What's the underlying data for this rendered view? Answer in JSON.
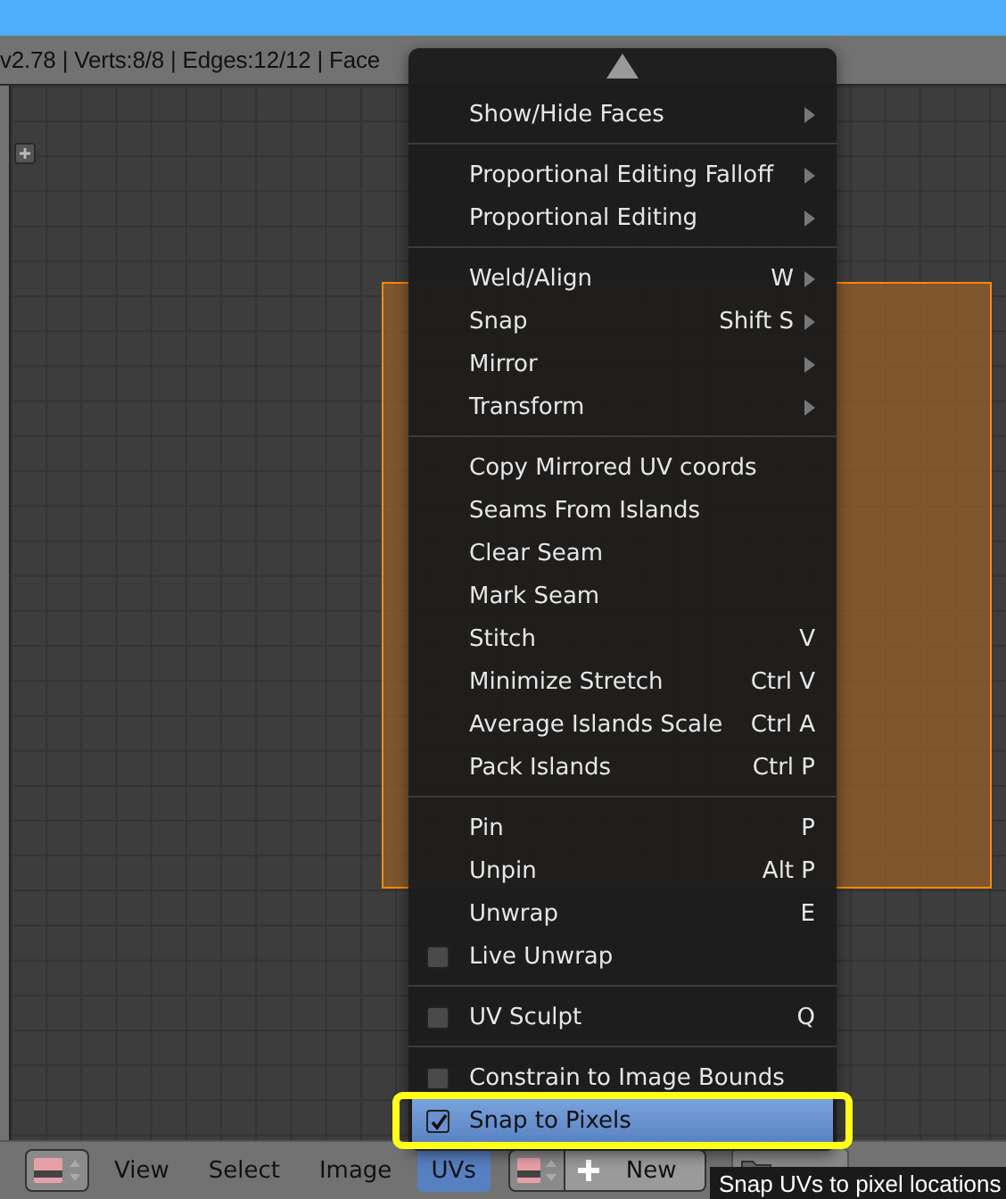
{
  "info_bar": {
    "text": "v2.78 | Verts:8/8 | Edges:12/12 | Face"
  },
  "menu": {
    "sections": [
      {
        "items": [
          {
            "kind": "item",
            "label": "Show/Hide Faces",
            "submenu": true,
            "selected": false
          }
        ]
      },
      {
        "items": [
          {
            "kind": "item",
            "label": "Proportional Editing Falloff",
            "submenu": true,
            "selected": false
          },
          {
            "kind": "item",
            "label": "Proportional Editing",
            "submenu": true,
            "selected": false
          }
        ]
      },
      {
        "items": [
          {
            "kind": "item",
            "label": "Weld/Align",
            "shortcut": "W",
            "submenu": true,
            "selected": false
          },
          {
            "kind": "item",
            "label": "Snap",
            "shortcut": "Shift S",
            "submenu": true,
            "selected": false
          },
          {
            "kind": "item",
            "label": "Mirror",
            "submenu": true,
            "selected": false
          },
          {
            "kind": "item",
            "label": "Transform",
            "submenu": true,
            "selected": false
          }
        ]
      },
      {
        "items": [
          {
            "kind": "item",
            "label": "Copy Mirrored UV coords",
            "selected": false
          },
          {
            "kind": "item",
            "label": "Seams From Islands",
            "selected": false
          },
          {
            "kind": "item",
            "label": "Clear Seam",
            "selected": false
          },
          {
            "kind": "item",
            "label": "Mark Seam",
            "selected": false
          },
          {
            "kind": "item",
            "label": "Stitch",
            "shortcut": "V",
            "selected": false
          },
          {
            "kind": "item",
            "label": "Minimize Stretch",
            "shortcut": "Ctrl V",
            "selected": false
          },
          {
            "kind": "item",
            "label": "Average Islands Scale",
            "shortcut": "Ctrl A",
            "selected": false
          },
          {
            "kind": "item",
            "label": "Pack Islands",
            "shortcut": "Ctrl P",
            "selected": false
          }
        ]
      },
      {
        "items": [
          {
            "kind": "item",
            "label": "Pin",
            "shortcut": "P",
            "selected": false
          },
          {
            "kind": "item",
            "label": "Unpin",
            "shortcut": "Alt P",
            "selected": false
          },
          {
            "kind": "item",
            "label": "Unwrap",
            "shortcut": "E",
            "selected": false
          },
          {
            "kind": "check",
            "label": "Live Unwrap",
            "checked": false,
            "selected": false
          }
        ]
      },
      {
        "items": [
          {
            "kind": "check",
            "label": "UV Sculpt",
            "shortcut": "Q",
            "checked": false,
            "selected": false
          }
        ]
      },
      {
        "items": [
          {
            "kind": "check",
            "label": "Constrain to Image Bounds",
            "checked": false,
            "selected": false
          },
          {
            "kind": "check",
            "label": "Snap to Pixels",
            "checked": true,
            "selected": true
          }
        ]
      }
    ]
  },
  "header": {
    "menus": [
      {
        "label": "View",
        "selected": false
      },
      {
        "label": "Select",
        "selected": false
      },
      {
        "label": "Image",
        "selected": false
      },
      {
        "label": "UVs",
        "selected": true
      }
    ],
    "new_button": "New"
  },
  "tooltip": "Snap UVs to pixel locations"
}
